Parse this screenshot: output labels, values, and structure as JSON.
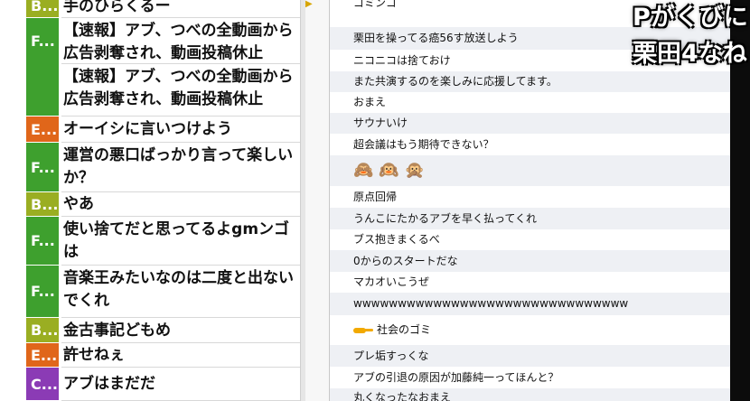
{
  "left_comments": [
    {
      "badge": "B...",
      "color": "#9aae22",
      "text": "手のひらくるー"
    },
    {
      "badge": "F...",
      "color": "#3ea02e",
      "text": "【速報】アブ、つべの全動画から広告剥奪され、動画投稿休止"
    },
    {
      "badge": "",
      "color": "#3ea02e",
      "text": "【速報】アブ、つべの全動画から広告剥奪され、動画投稿休止"
    },
    {
      "badge": "E...",
      "color": "#e0661a",
      "text": "オーイシに言いつけよう"
    },
    {
      "badge": "F...",
      "color": "#3ea02e",
      "text": "運営の悪口ばっかり言って楽しいか？"
    },
    {
      "badge": "B...",
      "color": "#9aae22",
      "text": "やあ"
    },
    {
      "badge": "F...",
      "color": "#3ea02e",
      "text": "使い捨てだと思ってるよgmンゴは"
    },
    {
      "badge": "F...",
      "color": "#3ea02e",
      "text": "音楽王みたいなのは二度と出ないでくれ"
    },
    {
      "badge": "B...",
      "color": "#9aae22",
      "text": "金古事記どもめ"
    },
    {
      "badge": "E...",
      "color": "#e0661a",
      "text": "許せねぇ"
    },
    {
      "badge": "C...",
      "color": "#8b3bb5",
      "text": "アブはまだだ"
    }
  ],
  "chat_messages": [
    "ゴミンゴ",
    "栗田を操ってる癌56す放送しよう",
    "ニコニコは捨ておけ",
    "また共演するのを楽しみに応援してます。",
    "おまえ",
    "サウナいけ",
    "超会議はもう期待できない？",
    "🙈🙉🙊",
    "原点回帰",
    "うんこにたかるアブを早く払ってくれ",
    "ブス抱きまくるべ",
    "0からのスタートだな",
    "マカオいこうぜ",
    "wwwwwwwwwwwwwwwwwwwwwwwwwwwwwww",
    "社会のゴミ",
    "プレ垢すっくな",
    "アブの引退の原因が加藤純一ってほんと？",
    "丸くなったなおまえ"
  ],
  "overlay_lines": [
    "Pがくびに",
    "栗田4なね"
  ]
}
